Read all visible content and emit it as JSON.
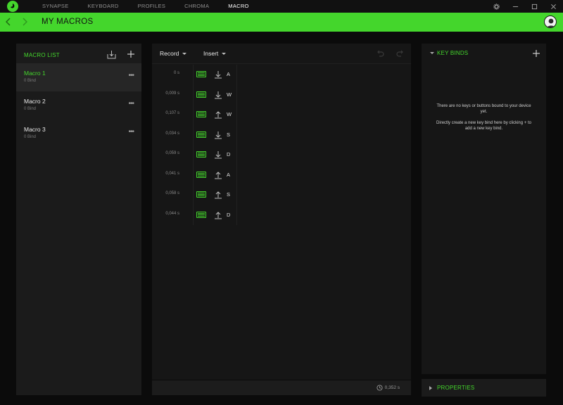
{
  "app": {
    "tabs": [
      {
        "label": "SYNAPSE",
        "active": false
      },
      {
        "label": "KEYBOARD",
        "active": false
      },
      {
        "label": "PROFILES",
        "active": false
      },
      {
        "label": "CHROMA",
        "active": false
      },
      {
        "label": "MACRO",
        "active": true
      }
    ],
    "window_icons": [
      "gear-icon",
      "minimize-icon",
      "maximize-icon",
      "close-icon"
    ]
  },
  "header": {
    "title": "MY MACROS",
    "accent_color": "#44d62c"
  },
  "macro_list": {
    "title": "MACRO LIST",
    "items": [
      {
        "name": "Macro 1",
        "sub": "0 Bind",
        "selected": true
      },
      {
        "name": "Macro 2",
        "sub": "0 Bind",
        "selected": false
      },
      {
        "name": "Macro 3",
        "sub": "0 Bind",
        "selected": false
      }
    ]
  },
  "editor": {
    "record_label": "Record",
    "insert_label": "Insert",
    "events": [
      {
        "time": "0 s",
        "direction": "down",
        "key": "A"
      },
      {
        "time": "0,009 s",
        "direction": "down",
        "key": "W"
      },
      {
        "time": "0,107 s",
        "direction": "up",
        "key": "W"
      },
      {
        "time": "0,034 s",
        "direction": "down",
        "key": "S"
      },
      {
        "time": "0,059 s",
        "direction": "down",
        "key": "D"
      },
      {
        "time": "0,041 s",
        "direction": "up",
        "key": "A"
      },
      {
        "time": "0,058 s",
        "direction": "up",
        "key": "S"
      },
      {
        "time": "0,044 s",
        "direction": "up",
        "key": "D"
      }
    ],
    "total_time": "0,352 s"
  },
  "key_binds": {
    "title": "KEY BINDS",
    "message_line1": "There are no keys or buttons bound to your device yet.",
    "message_line2": "Directly create a new key bind here by clicking + to add a new key bind."
  },
  "properties": {
    "title": "PROPERTIES"
  }
}
